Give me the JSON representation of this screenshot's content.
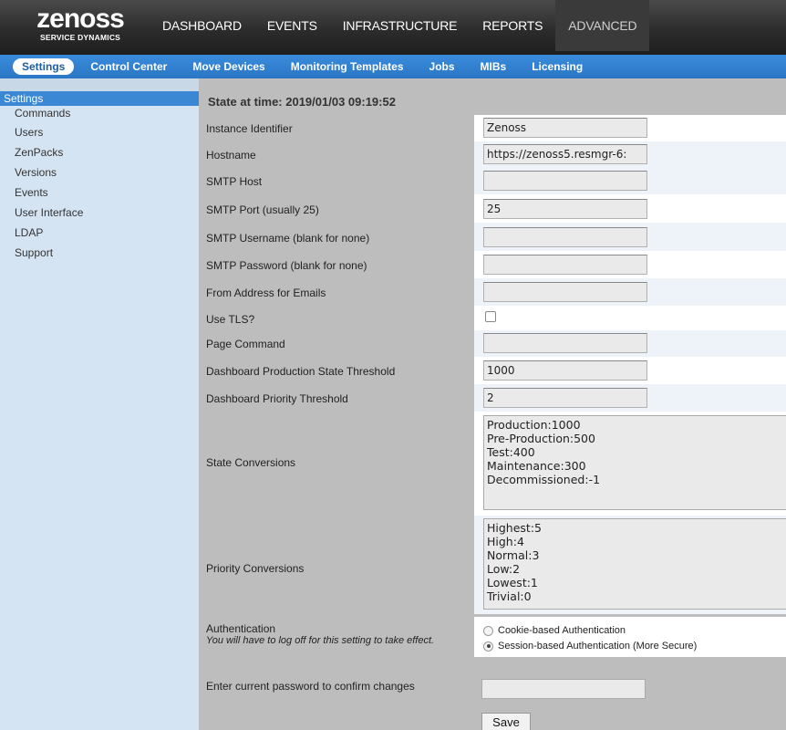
{
  "header": {
    "logo_word": "zenoss",
    "logo_sub": "SERVICE DYNAMICS",
    "nav": [
      "DASHBOARD",
      "EVENTS",
      "INFRASTRUCTURE",
      "REPORTS",
      "ADVANCED"
    ],
    "active_nav": "ADVANCED"
  },
  "subnav": {
    "items": [
      "Settings",
      "Control Center",
      "Move Devices",
      "Monitoring Templates",
      "Jobs",
      "MIBs",
      "Licensing"
    ],
    "active": "Settings"
  },
  "sidebar": {
    "items": [
      "Settings",
      "Commands",
      "Users",
      "ZenPacks",
      "Versions",
      "Events",
      "User Interface",
      "LDAP",
      "Support"
    ],
    "active": "Settings"
  },
  "main": {
    "state_title": "State at time: 2019/01/03 09:19:52",
    "fields": [
      {
        "label": "Instance Identifier",
        "value": "Zenoss"
      },
      {
        "label": "Hostname",
        "value": "https://zenoss5.resmgr-6:"
      },
      {
        "label": "SMTP Host",
        "value": ""
      },
      {
        "label": "SMTP Port (usually 25)",
        "value": "25"
      },
      {
        "label": "SMTP Username (blank for none)",
        "value": ""
      },
      {
        "label": "SMTP Password (blank for none)",
        "value": ""
      },
      {
        "label": "From Address for Emails",
        "value": ""
      },
      {
        "label": "Use TLS?",
        "value": ""
      },
      {
        "label": "Page Command",
        "value": ""
      },
      {
        "label": "Dashboard Production State Threshold",
        "value": "1000"
      },
      {
        "label": "Dashboard Priority Threshold",
        "value": "2"
      }
    ],
    "state_conversions": {
      "label": "State Conversions",
      "lines": [
        "Production:1000",
        "Pre-Production:500",
        "Test:400",
        "Maintenance:300",
        "Decommissioned:-1"
      ]
    },
    "priority_conversions": {
      "label": "Priority Conversions",
      "lines": [
        "Highest:5",
        "High:4",
        "Normal:3",
        "Low:2",
        "Lowest:1",
        "Trivial:0"
      ]
    },
    "authentication": {
      "label": "Authentication",
      "note": "You will have to log off for this setting to take effect.",
      "options": [
        "Cookie-based Authentication",
        "Session-based Authentication (More Secure)"
      ],
      "selected": "Session-based Authentication (More Secure)"
    },
    "confirm_label": "Enter current password to confirm changes",
    "save_label": "Save"
  }
}
